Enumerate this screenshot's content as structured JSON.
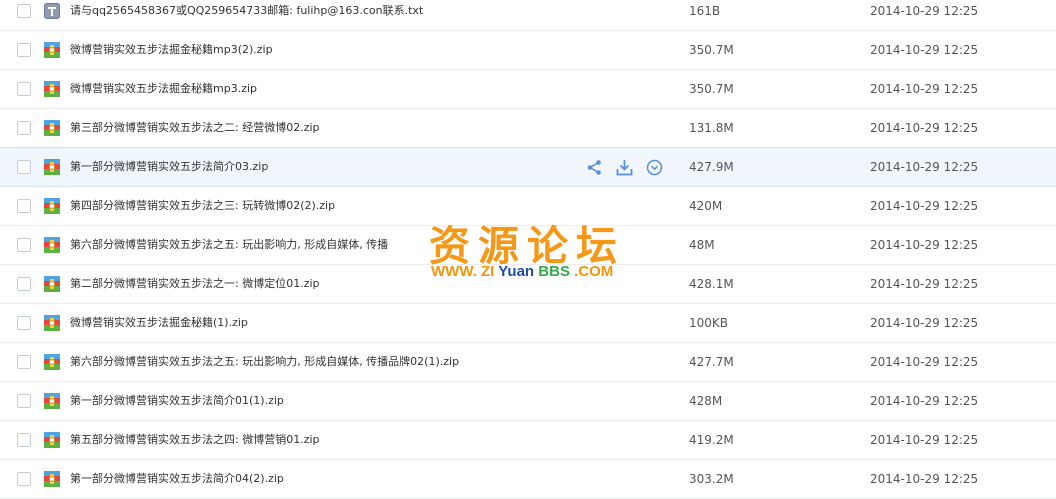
{
  "files": [
    {
      "name": "请与qq2565458367或QQ259654733邮箱: fulihp@163.con联系.txt",
      "size": "161B",
      "date": "2014-10-29 12:25",
      "icon": "txt-file-icon"
    },
    {
      "name": "微博营销实效五步法掘金秘籍mp3(2).zip",
      "size": "350.7M",
      "date": "2014-10-29 12:25",
      "icon": "zip-file-icon"
    },
    {
      "name": "微博营销实效五步法掘金秘籍mp3.zip",
      "size": "350.7M",
      "date": "2014-10-29 12:25",
      "icon": "zip-file-icon"
    },
    {
      "name": "第三部分微博营销实效五步法之二: 经营微博02.zip",
      "size": "131.8M",
      "date": "2014-10-29 12:25",
      "icon": "zip-file-icon"
    },
    {
      "name": "第一部分微博营销实效五步法简介03.zip",
      "size": "427.9M",
      "date": "2014-10-29 12:25",
      "icon": "zip-file-icon"
    },
    {
      "name": "第四部分微博营销实效五步法之三: 玩转微博02(2).zip",
      "size": "420M",
      "date": "2014-10-29 12:25",
      "icon": "zip-file-icon"
    },
    {
      "name": "第六部分微博营销实效五步法之五: 玩出影响力, 形成自媒体, 传播",
      "size": "48M",
      "date": "2014-10-29 12:25",
      "icon": "zip-file-icon"
    },
    {
      "name": "第二部分微博营销实效五步法之一: 微博定位01.zip",
      "size": "428.1M",
      "date": "2014-10-29 12:25",
      "icon": "zip-file-icon"
    },
    {
      "name": "微博营销实效五步法掘金秘籍(1).zip",
      "size": "100KB",
      "date": "2014-10-29 12:25",
      "icon": "zip-file-icon"
    },
    {
      "name": "第六部分微博营销实效五步法之五: 玩出影响力, 形成自媒体, 传播品牌02(1).zip",
      "size": "427.7M",
      "date": "2014-10-29 12:25",
      "icon": "zip-file-icon"
    },
    {
      "name": "第一部分微博营销实效五步法简介01(1).zip",
      "size": "428M",
      "date": "2014-10-29 12:25",
      "icon": "zip-file-icon"
    },
    {
      "name": "第五部分微博营销实效五步法之四: 微博营销01.zip",
      "size": "419.2M",
      "date": "2014-10-29 12:25",
      "icon": "zip-file-icon"
    },
    {
      "name": "第一部分微博营销实效五步法简介04(2).zip",
      "size": "303.2M",
      "date": "2014-10-29 12:25",
      "icon": "zip-file-icon"
    }
  ],
  "hover_row_index": 4,
  "hover_actions": [
    "share-icon",
    "download-icon",
    "more-icon"
  ],
  "watermark": {
    "cn": "资源论坛",
    "en_www": "WWW.",
    "en_zi": "ZI",
    "en_yuan": "Yuan",
    "en_bbs": "BBS",
    "en_com": ".COM"
  },
  "colors": {
    "accent_blue": "#5b8fd6",
    "watermark_orange": "#f5930e",
    "hover_row_bg": "#f1f6fd"
  }
}
